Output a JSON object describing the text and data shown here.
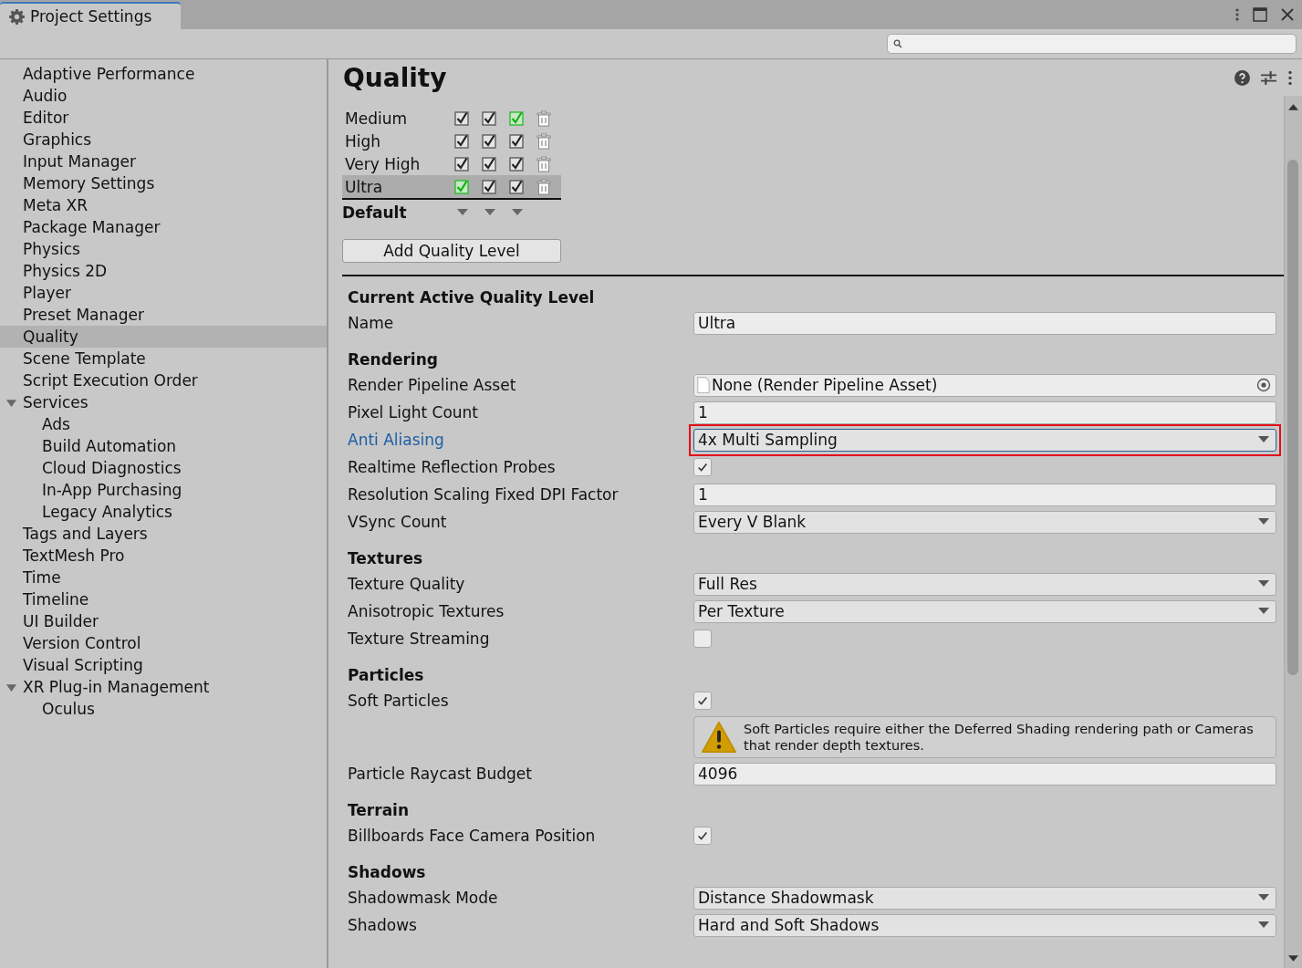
{
  "window": {
    "tab_title": "Project Settings"
  },
  "sidebar": {
    "items": [
      {
        "label": "Adaptive Performance",
        "selected": false
      },
      {
        "label": "Audio",
        "selected": false
      },
      {
        "label": "Editor",
        "selected": false
      },
      {
        "label": "Graphics",
        "selected": false
      },
      {
        "label": "Input Manager",
        "selected": false
      },
      {
        "label": "Memory Settings",
        "selected": false
      },
      {
        "label": "Meta XR",
        "selected": false
      },
      {
        "label": "Package Manager",
        "selected": false
      },
      {
        "label": "Physics",
        "selected": false
      },
      {
        "label": "Physics 2D",
        "selected": false
      },
      {
        "label": "Player",
        "selected": false
      },
      {
        "label": "Preset Manager",
        "selected": false
      },
      {
        "label": "Quality",
        "selected": true
      },
      {
        "label": "Scene Template",
        "selected": false
      },
      {
        "label": "Script Execution Order",
        "selected": false
      },
      {
        "label": "Services",
        "selected": false,
        "expanded": true,
        "children": [
          {
            "label": "Ads",
            "selected": false
          },
          {
            "label": "Build Automation",
            "selected": false
          },
          {
            "label": "Cloud Diagnostics",
            "selected": false
          },
          {
            "label": "In-App Purchasing",
            "selected": false
          },
          {
            "label": "Legacy Analytics",
            "selected": false
          }
        ]
      },
      {
        "label": "Tags and Layers",
        "selected": false
      },
      {
        "label": "TextMesh Pro",
        "selected": false
      },
      {
        "label": "Time",
        "selected": false
      },
      {
        "label": "Timeline",
        "selected": false
      },
      {
        "label": "UI Builder",
        "selected": false
      },
      {
        "label": "Version Control",
        "selected": false
      },
      {
        "label": "Visual Scripting",
        "selected": false
      },
      {
        "label": "XR Plug-in Management",
        "selected": false,
        "expanded": true,
        "children": [
          {
            "label": "Oculus",
            "selected": false
          }
        ]
      }
    ]
  },
  "page": {
    "title": "Quality"
  },
  "levels": {
    "rows": [
      {
        "name": "Medium",
        "selected": false,
        "platforms": [
          {
            "checked": true,
            "is_default": false
          },
          {
            "checked": true,
            "is_default": false
          },
          {
            "checked": true,
            "is_default": true
          }
        ]
      },
      {
        "name": "High",
        "selected": false,
        "platforms": [
          {
            "checked": true,
            "is_default": false
          },
          {
            "checked": true,
            "is_default": false
          },
          {
            "checked": true,
            "is_default": false
          }
        ]
      },
      {
        "name": "Very High",
        "selected": false,
        "platforms": [
          {
            "checked": true,
            "is_default": false
          },
          {
            "checked": true,
            "is_default": false
          },
          {
            "checked": true,
            "is_default": false
          }
        ]
      },
      {
        "name": "Ultra",
        "selected": true,
        "platforms": [
          {
            "checked": true,
            "is_default": true
          },
          {
            "checked": true,
            "is_default": false
          },
          {
            "checked": true,
            "is_default": false
          }
        ]
      }
    ],
    "default_label": "Default",
    "add_button": "Add Quality Level"
  },
  "sections": [
    {
      "title": "Current Active Quality Level",
      "rows": [
        {
          "kind": "text",
          "label": "Name",
          "value": "Ultra",
          "highlighted": false
        }
      ]
    },
    {
      "title": "Rendering",
      "rows": [
        {
          "kind": "object",
          "label": "Render Pipeline Asset",
          "value": "None (Render Pipeline Asset)",
          "highlighted": false
        },
        {
          "kind": "text",
          "label": "Pixel Light Count",
          "value": "1",
          "highlighted": false
        },
        {
          "kind": "dropdown",
          "label": "Anti Aliasing",
          "value": "4x Multi Sampling",
          "highlighted": true
        },
        {
          "kind": "checkbox",
          "label": "Realtime Reflection Probes",
          "checked": true,
          "highlighted": false
        },
        {
          "kind": "text",
          "label": "Resolution Scaling Fixed DPI Factor",
          "value": "1",
          "highlighted": false
        },
        {
          "kind": "dropdown",
          "label": "VSync Count",
          "value": "Every V Blank",
          "highlighted": false
        }
      ]
    },
    {
      "title": "Textures",
      "rows": [
        {
          "kind": "dropdown",
          "label": "Texture Quality",
          "value": "Full Res",
          "highlighted": false
        },
        {
          "kind": "dropdown",
          "label": "Anisotropic Textures",
          "value": "Per Texture",
          "highlighted": false
        },
        {
          "kind": "checkbox",
          "label": "Texture Streaming",
          "checked": false,
          "highlighted": false
        }
      ]
    },
    {
      "title": "Particles",
      "rows": [
        {
          "kind": "checkbox",
          "label": "Soft Particles",
          "checked": true,
          "highlighted": false
        },
        {
          "kind": "warning",
          "text": "Soft Particles require either the Deferred Shading rendering path or Cameras that render depth textures."
        },
        {
          "kind": "text",
          "label": "Particle Raycast Budget",
          "value": "4096",
          "highlighted": false
        }
      ]
    },
    {
      "title": "Terrain",
      "rows": [
        {
          "kind": "checkbox",
          "label": "Billboards Face Camera Position",
          "checked": true,
          "highlighted": false
        }
      ]
    },
    {
      "title": "Shadows",
      "rows": [
        {
          "kind": "dropdown",
          "label": "Shadowmask Mode",
          "value": "Distance Shadowmask",
          "highlighted": false
        },
        {
          "kind": "dropdown",
          "label": "Shadows",
          "value": "Hard and Soft Shadows",
          "highlighted": false
        }
      ]
    }
  ]
}
